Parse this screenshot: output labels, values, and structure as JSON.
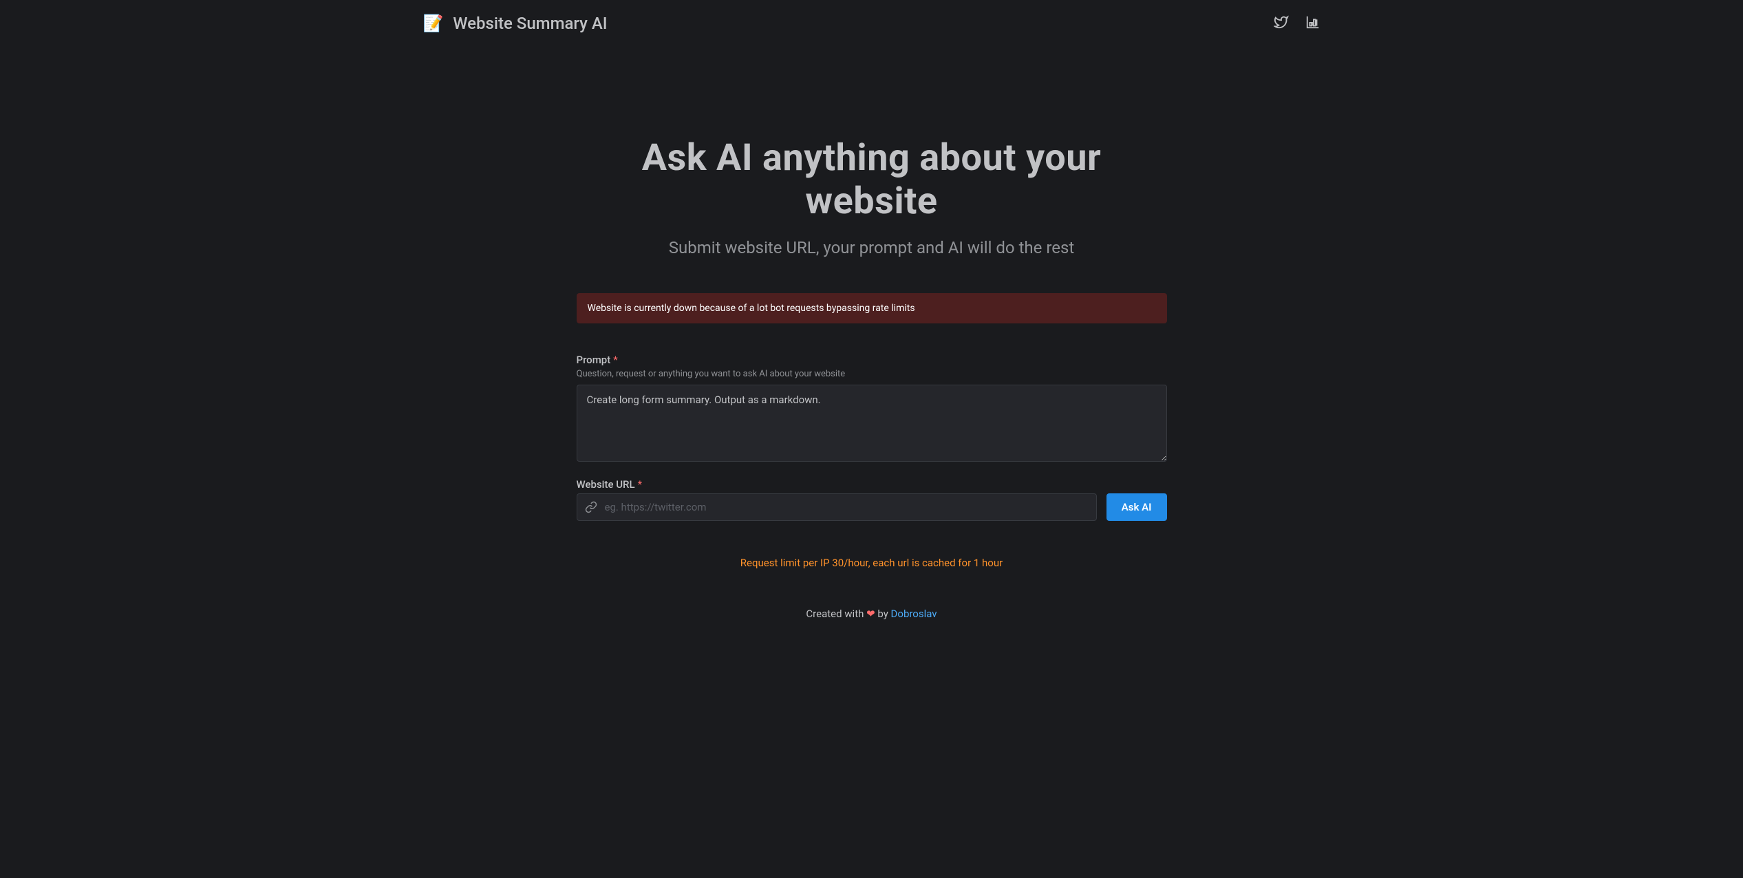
{
  "header": {
    "logo_emoji": "📝",
    "title": "Website Summary AI"
  },
  "hero": {
    "title": "Ask AI anything about your website",
    "subtitle": "Submit website URL, your prompt and AI will do the rest"
  },
  "alert": {
    "message": "Website is currently down because of a lot bot requests bypassing rate limits"
  },
  "form": {
    "prompt": {
      "label": "Prompt",
      "required_mark": "*",
      "help": "Question, request or anything you want to ask AI about your website",
      "value": "Create long form summary. Output as a markdown."
    },
    "url": {
      "label": "Website URL",
      "required_mark": "*",
      "placeholder": "eg. https://twitter.com",
      "value": ""
    },
    "submit_label": "Ask AI"
  },
  "rate_limit": "Request limit per IP 30/hour, each url is cached for 1 hour",
  "footer": {
    "prefix": "Created with ",
    "heart": "❤",
    "by": " by ",
    "author": "Dobroslav"
  }
}
